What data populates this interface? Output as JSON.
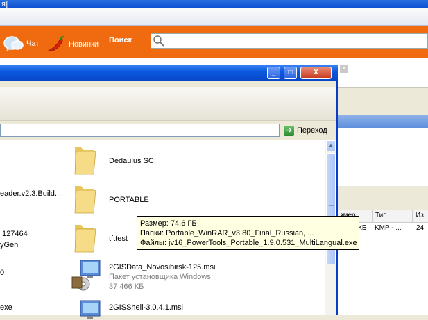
{
  "background": {
    "window_title": "я]",
    "site_nav": {
      "chat_label": "Чат",
      "new_label": "Новинки",
      "search_label": "Поиск",
      "search_placeholder": ""
    },
    "grid": {
      "headers": [
        "змер",
        "Тип",
        "Из"
      ],
      "row": [
        "КБ",
        "KMP - ...",
        "24."
      ]
    },
    "close_glyph": "×"
  },
  "explorer": {
    "window_buttons": {
      "minimize": "_",
      "maximize": "□",
      "close": "X"
    },
    "address": {
      "value": "",
      "go_label": "Переход",
      "dropdown_glyph": "▼"
    },
    "left_column": [
      {
        "name": "eader.v2.3.Build...."
      },
      {
        "name": ".127464"
      },
      {
        "name": "yGen"
      },
      {
        "name": "0"
      },
      {
        "name": "exe"
      }
    ],
    "right_column": [
      {
        "name": "Dedaulus SC",
        "type": "folder"
      },
      {
        "name": "PORTABLE",
        "type": "folder"
      },
      {
        "name": "tfttest",
        "type": "folder"
      },
      {
        "name": "2GISData_Novosibirsk-125.msi",
        "type": "msi",
        "desc": "Пакет установщика Windows",
        "size": "37 466 КБ"
      },
      {
        "name": "2GISShell-3.0.4.1.msi",
        "type": "msi"
      }
    ]
  },
  "tooltip": {
    "size_line": "Размер: 74,6 ГБ",
    "folders_line": "Папки: Portable_WinRAR_v3.80_Final_Russian, ...",
    "files_line": "Файлы: jv16_PowerTools_Portable_1.9.0.531_MultiLangual.exe"
  },
  "colors": {
    "orange_bar": "#f06a0f",
    "xp_blue": "#0a57dd",
    "tooltip_bg": "#ffffe1"
  }
}
